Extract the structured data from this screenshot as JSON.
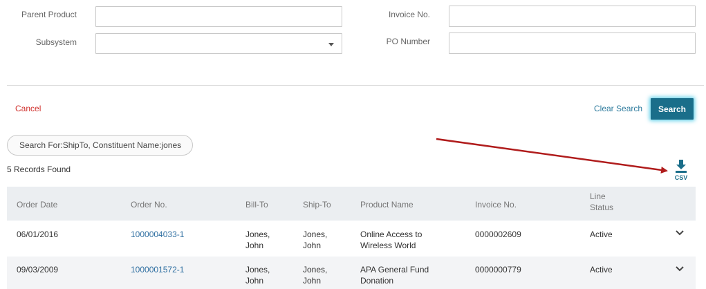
{
  "form": {
    "parent_product_label": "Parent Product",
    "parent_product_value": "",
    "subsystem_label": "Subsystem",
    "subsystem_value": "",
    "invoice_label": "Invoice No.",
    "invoice_value": "",
    "po_label": "PO Number",
    "po_value": ""
  },
  "actions": {
    "cancel": "Cancel",
    "clear_search": "Clear Search",
    "search": "Search"
  },
  "filter_chip": "Search For:ShipTo, Constituent Name:jones",
  "records_found": "5 Records Found",
  "export": {
    "label": "CSV",
    "icon": "download-icon"
  },
  "table": {
    "headers": {
      "order_date": "Order Date",
      "order_no": "Order No.",
      "bill_to": "Bill-To",
      "ship_to": "Ship-To",
      "product_name": "Product Name",
      "invoice_no": "Invoice No.",
      "line_status_1": "Line",
      "line_status_2": "Status"
    },
    "rows": [
      {
        "order_date": "06/01/2016",
        "order_no": "1000004033-1",
        "bill_to_1": "Jones,",
        "bill_to_2": "John",
        "ship_to_1": "Jones,",
        "ship_to_2": "John",
        "product_1": "Online Access to",
        "product_2": "Wireless World",
        "invoice_no": "0000002609",
        "status": "Active"
      },
      {
        "order_date": "09/03/2009",
        "order_no": "1000001572-1",
        "bill_to_1": "Jones,",
        "bill_to_2": "John",
        "ship_to_1": "Jones,",
        "ship_to_2": "John",
        "product_1": "APA General Fund",
        "product_2": "Donation",
        "invoice_no": "0000000779",
        "status": "Active"
      }
    ]
  },
  "colors": {
    "primary": "#1a6e8a",
    "link": "#2f6fa1",
    "cancel": "#d0312d",
    "annotation_arrow": "#b01c1c",
    "header_bg": "#ebeef1"
  }
}
